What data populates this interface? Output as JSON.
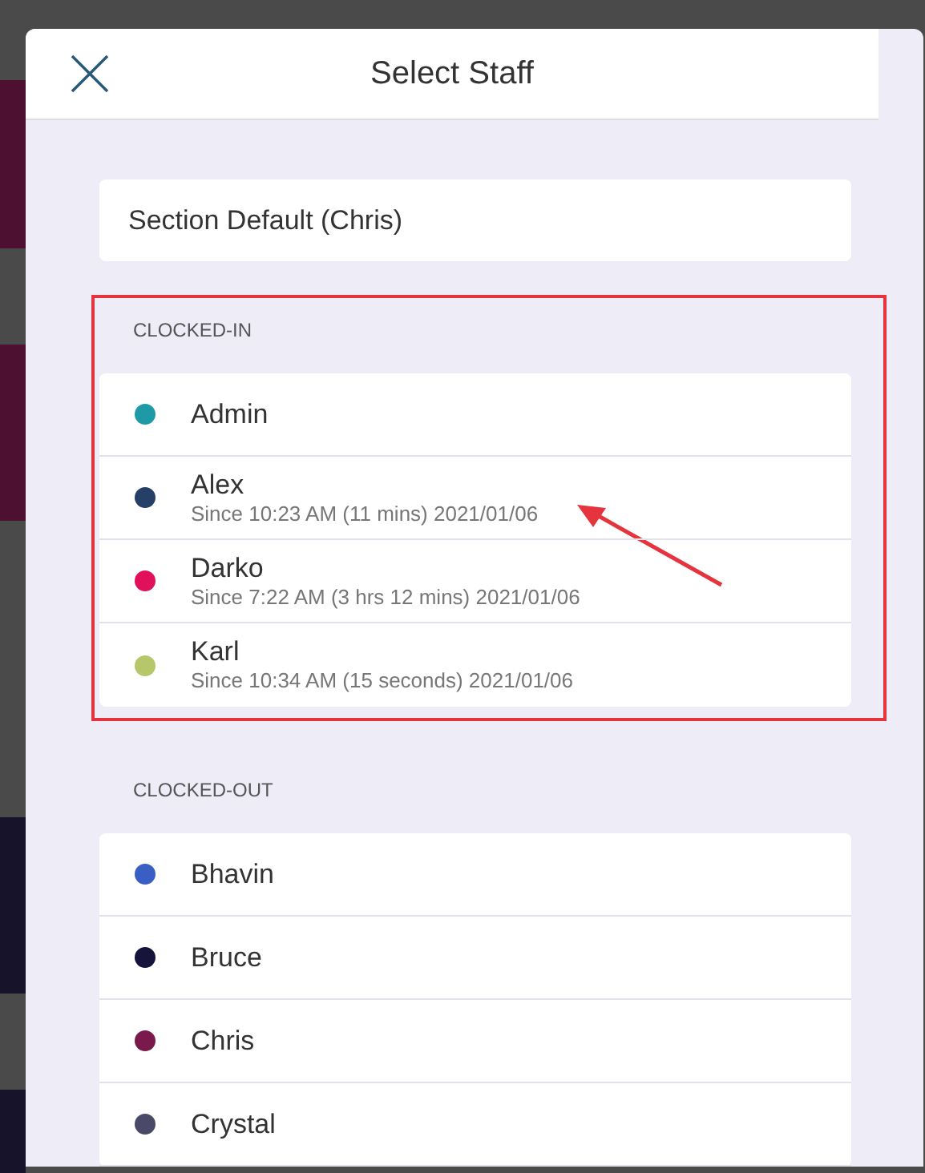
{
  "dialog": {
    "title": "Select Staff"
  },
  "default_option": {
    "label": "Section Default (Chris)"
  },
  "sections": [
    {
      "heading": "CLOCKED-IN",
      "highlighted": true,
      "staff": [
        {
          "name": "Admin",
          "color": "#1e9aa6"
        },
        {
          "name": "Alex",
          "color": "#253f66",
          "detail": "Since 10:23 AM (11 mins) 2021/01/06",
          "arrow": true
        },
        {
          "name": "Darko",
          "color": "#e0115a",
          "detail": "Since 7:22 AM (3 hrs 12 mins) 2021/01/06"
        },
        {
          "name": "Karl",
          "color": "#b6c66a",
          "detail": "Since 10:34 AM (15 seconds) 2021/01/06"
        }
      ]
    },
    {
      "heading": "CLOCKED-OUT",
      "highlighted": false,
      "staff": [
        {
          "name": "Bhavin",
          "color": "#3a5fc4"
        },
        {
          "name": "Bruce",
          "color": "#16143a"
        },
        {
          "name": "Chris",
          "color": "#7a1a4c"
        },
        {
          "name": "Crystal",
          "color": "#4a4a68"
        }
      ]
    }
  ]
}
